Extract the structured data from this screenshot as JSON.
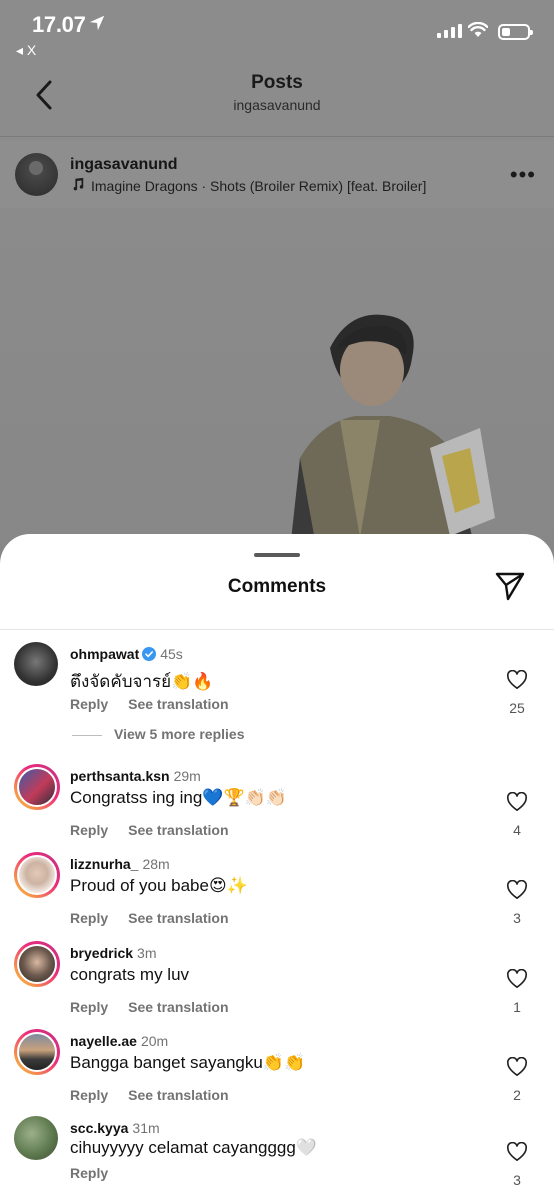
{
  "status_bar": {
    "time": "17.07",
    "back_app": "◂ X"
  },
  "nav": {
    "title": "Posts",
    "subtitle": "ingasavanund"
  },
  "post": {
    "username": "ingasavanund",
    "song": "Imagine Dragons · Shots (Broiler Remix) [feat. Broiler]"
  },
  "sheet": {
    "title": "Comments"
  },
  "comments": [
    {
      "user": "ohmpawat",
      "time": "45s",
      "verified": true,
      "text": "ตึงจัดคับจารย์👏🔥",
      "actions": [
        "Reply",
        "See translation"
      ],
      "likes": "25",
      "view_replies": "View 5 more replies"
    },
    {
      "user": "perthsanta.ksn",
      "time": "29m",
      "text": "Congratss ing ing💙🏆👏🏻👏🏻",
      "actions": [
        "Reply",
        "See translation"
      ],
      "likes": "4"
    },
    {
      "user": "lizznurha_",
      "time": "28m",
      "text": "Proud of you babe😍✨",
      "actions": [
        "Reply",
        "See translation"
      ],
      "likes": "3"
    },
    {
      "user": "bryedrick",
      "time": "3m",
      "text": "congrats my luv",
      "actions": [
        "Reply",
        "See translation"
      ],
      "likes": "1"
    },
    {
      "user": "nayelle.ae",
      "time": "20m",
      "text": "Bangga banget sayangku👏👏",
      "actions": [
        "Reply",
        "See translation"
      ],
      "likes": "2"
    },
    {
      "user": "scc.kyya",
      "time": "31m",
      "text": "cihuyyyyy celamat cayangggg🤍",
      "actions": [
        "Reply"
      ],
      "likes": "3"
    }
  ],
  "icons": [
    "location-arrow-icon",
    "signal-icon",
    "wifi-icon",
    "battery-icon",
    "back-chevron-icon",
    "music-note-icon",
    "more-dots-icon",
    "send-icon",
    "verified-badge-icon",
    "heart-icon"
  ],
  "colors": {
    "verified": "#3897f0",
    "story_ring_start": "#f9ce34",
    "story_ring_end": "#c13584",
    "muted_text": "#737373"
  }
}
